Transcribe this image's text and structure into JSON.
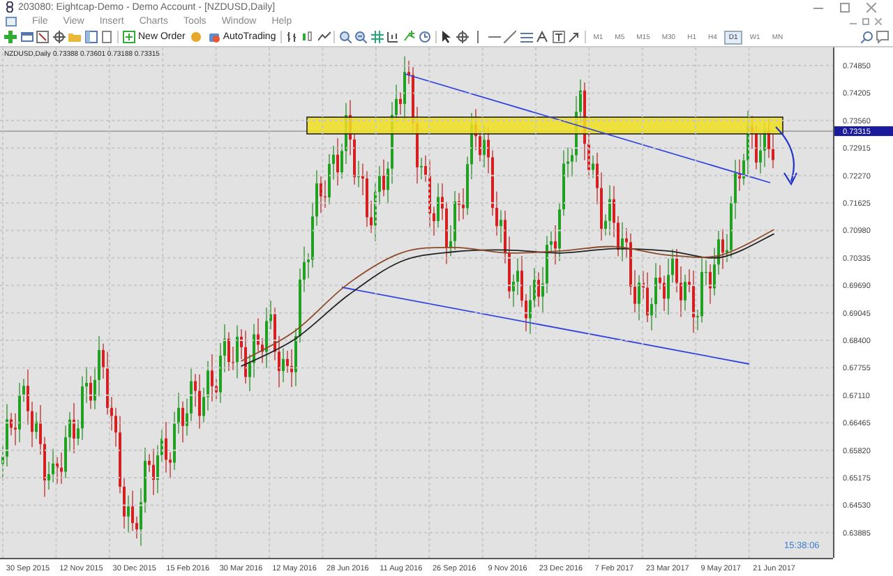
{
  "window": {
    "title": "203080: Eightcap-Demo - Demo Account - [NZDUSD,Daily]"
  },
  "menu": [
    "File",
    "View",
    "Insert",
    "Charts",
    "Tools",
    "Window",
    "Help"
  ],
  "toolbar": {
    "buttons": [
      "New Order",
      "AutoTrading"
    ],
    "timeframes": [
      {
        "label": "M1",
        "selected": false
      },
      {
        "label": "M5",
        "selected": false
      },
      {
        "label": "M15",
        "selected": false
      },
      {
        "label": "M30",
        "selected": false
      },
      {
        "label": "H1",
        "selected": false
      },
      {
        "label": "H4",
        "selected": false
      },
      {
        "label": "D1",
        "selected": true
      },
      {
        "label": "W1",
        "selected": false
      },
      {
        "label": "MN",
        "selected": false
      }
    ]
  },
  "chart": {
    "symbol": "NZDUSD,Daily",
    "ohlc": "0.73388 0.73601 0.73188 0.73315",
    "current_price": "0.73315",
    "clock": "15:38:06",
    "chart_data": {
      "type": "line",
      "grid": true,
      "ylim": [
        0.63293,
        0.75276
      ],
      "categories": [
        "30 Sep 2015",
        "12 Nov 2015",
        "30 Dec 2015",
        "15 Feb 2016",
        "30 Mar 2016",
        "12 May 2016",
        "28 Jun 2016",
        "11 Aug 2016",
        "26 Sep 2016",
        "9 Nov 2016",
        "23 Dec 2016",
        "7 Feb 2017",
        "23 Mar 2017",
        "9 May 2017",
        "21 Jun 2017"
      ],
      "yticks": [
        {
          "value": 0.7485,
          "label": "0.74850"
        },
        {
          "value": 0.74205,
          "label": "0.74205"
        },
        {
          "value": 0.7356,
          "label": "0.73560"
        },
        {
          "value": 0.72915,
          "label": "0.72915"
        },
        {
          "value": 0.7227,
          "label": "0.72270"
        },
        {
          "value": 0.71625,
          "label": "0.71625"
        },
        {
          "value": 0.7098,
          "label": "0.70980"
        },
        {
          "value": 0.70335,
          "label": "0.70335"
        },
        {
          "value": 0.6969,
          "label": "0.69690"
        },
        {
          "value": 0.69045,
          "label": "0.69045"
        },
        {
          "value": 0.684,
          "label": "0.68400"
        },
        {
          "value": 0.67755,
          "label": "0.67755"
        },
        {
          "value": 0.6711,
          "label": "0.67110"
        },
        {
          "value": 0.66465,
          "label": "0.66465"
        },
        {
          "value": 0.6582,
          "label": "0.65820"
        },
        {
          "value": 0.65175,
          "label": "0.65175"
        },
        {
          "value": 0.6453,
          "label": "0.64530"
        },
        {
          "value": 0.63885,
          "label": "0.63885"
        }
      ],
      "series": [
        {
          "color": "#222222",
          "values": [
            null,
            null,
            null,
            null,
            0.6779,
            0.6842,
            0.6945,
            0.7025,
            0.7048,
            0.7052,
            0.7045,
            0.7055,
            0.705,
            0.7035,
            0.709
          ]
        },
        {
          "color": "#8b4a2a",
          "values": [
            null,
            null,
            null,
            null,
            0.6791,
            0.6861,
            0.6972,
            0.7045,
            0.7058,
            0.7045,
            0.705,
            0.706,
            0.704,
            0.704,
            0.71
          ]
        }
      ]
    }
  }
}
